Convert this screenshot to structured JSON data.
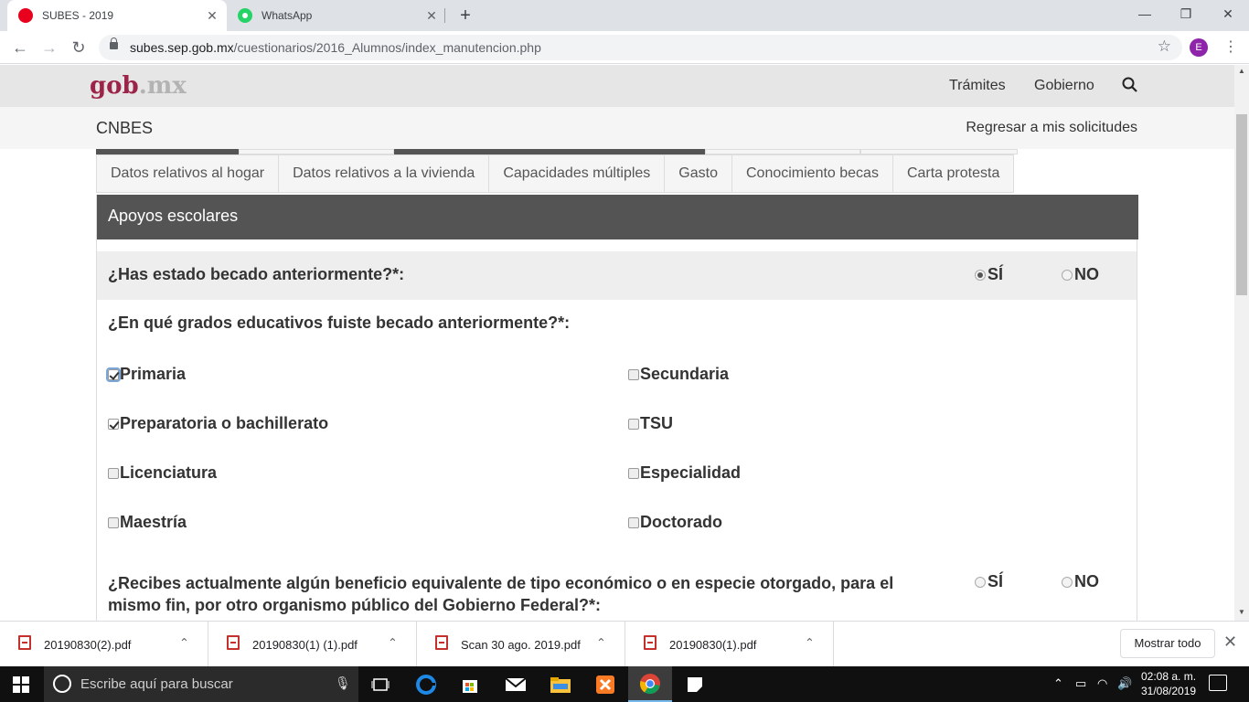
{
  "browser": {
    "tabs": [
      {
        "title": "SUBES - 2019",
        "close": "✕"
      },
      {
        "title": "WhatsApp",
        "close": "✕"
      }
    ],
    "new_tab": "+",
    "window": {
      "minimize": "—",
      "maximize": "❐",
      "close": "✕"
    },
    "nav": {
      "back": "←",
      "forward": "→",
      "reload": "↻"
    },
    "url_host": "subes.sep.gob.mx",
    "url_path": "/cuestionarios/2016_Alumnos/index_manutencion.php",
    "bookmark": "☆",
    "profile_initial": "E",
    "menu": "⋮"
  },
  "site": {
    "logo_main": "gob",
    "logo_suffix": ".mx",
    "links": [
      "Trámites",
      "Gobierno"
    ],
    "section": "CNBES",
    "back_link": "Regresar a mis solicitudes",
    "accent": "#9d2449"
  },
  "tabs": [
    "Datos relativos al hogar",
    "Datos relativos a la vivienda",
    "Capacidades múltiples",
    "Gasto",
    "Conocimiento becas",
    "Carta protesta"
  ],
  "panel_title": "Apoyos escolares",
  "questions": {
    "q1": {
      "text": "¿Has estado becado anteriormente?*:",
      "yes": "SÍ",
      "no": "NO",
      "selected": "yes"
    },
    "q2": {
      "text": "¿En qué grados educativos fuiste becado anteriormente?*:",
      "options": [
        {
          "label": "Primaria",
          "checked": true
        },
        {
          "label": "Secundaria",
          "checked": false
        },
        {
          "label": "Preparatoria o bachillerato",
          "checked": true
        },
        {
          "label": "TSU",
          "checked": false
        },
        {
          "label": "Licenciatura",
          "checked": false
        },
        {
          "label": "Especialidad",
          "checked": false
        },
        {
          "label": "Maestría",
          "checked": false
        },
        {
          "label": "Doctorado",
          "checked": false
        }
      ]
    },
    "q3": {
      "text": "¿Recibes actualmente algún beneficio equivalente de tipo económico o en especie otorgado, para el mismo fin, por otro organismo público del Gobierno Federal?*:",
      "yes": "SÍ",
      "no": "NO",
      "selected": null
    }
  },
  "downloads": {
    "items": [
      "20190830(2).pdf",
      "20190830(1) (1).pdf",
      "Scan 30 ago. 2019.pdf",
      "20190830(1).pdf"
    ],
    "show_all": "Mostrar todo",
    "close": "✕"
  },
  "taskbar": {
    "search_placeholder": "Escribe aquí para buscar",
    "time": "02:08 a. m.",
    "date": "31/08/2019"
  }
}
